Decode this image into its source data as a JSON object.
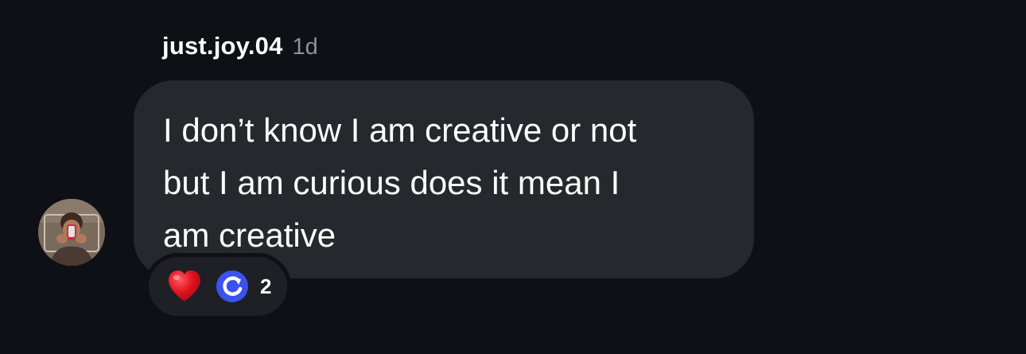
{
  "message": {
    "sender": "just.joy.04",
    "time": "1d",
    "lines": [
      "I don’t know I am creative or not",
      "but I am curious does it mean I",
      "am creative"
    ]
  },
  "avatar": {
    "icon": "user-avatar-photo"
  },
  "reactions": {
    "items": [
      {
        "icon": "heart-emoji-icon"
      },
      {
        "icon": "refresh-emoji-icon"
      }
    ],
    "count": "2"
  },
  "colors": {
    "background": "#0e1015",
    "bubble": "#26282d",
    "reaction_pill": "#1e2025",
    "timestamp": "#8e9197",
    "heart": "#e0121e",
    "refresh_badge": "#3a52f0"
  }
}
